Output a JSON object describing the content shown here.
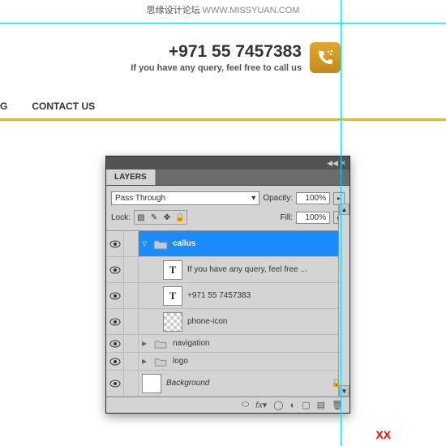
{
  "watermark": {
    "cn": "思缘设计论坛",
    "en": "WWW.MISSYUAN.COM"
  },
  "header": {
    "phone": "+971 55 7457383",
    "sub": "If you have any query, feel free to call us"
  },
  "nav": {
    "item1": "G",
    "item2": "CONTACT US"
  },
  "panel": {
    "title": "LAYERS",
    "blend": "Pass Through",
    "opacity_label": "Opacity:",
    "opacity_val": "100%",
    "lock_label": "Lock:",
    "fill_label": "Fill:",
    "fill_val": "100%",
    "layers": [
      {
        "name": "callus",
        "type": "folder",
        "selected": true
      },
      {
        "name": "If you have any query, feel free ...",
        "type": "text"
      },
      {
        "name": "+971 55 7457383",
        "type": "text"
      },
      {
        "name": "phone-icon",
        "type": "bitmap"
      },
      {
        "name": "navigation",
        "type": "folder-closed"
      },
      {
        "name": "logo",
        "type": "folder-closed"
      },
      {
        "name": "Background",
        "type": "bg",
        "locked": true
      }
    ]
  },
  "footer_mark": "XX"
}
